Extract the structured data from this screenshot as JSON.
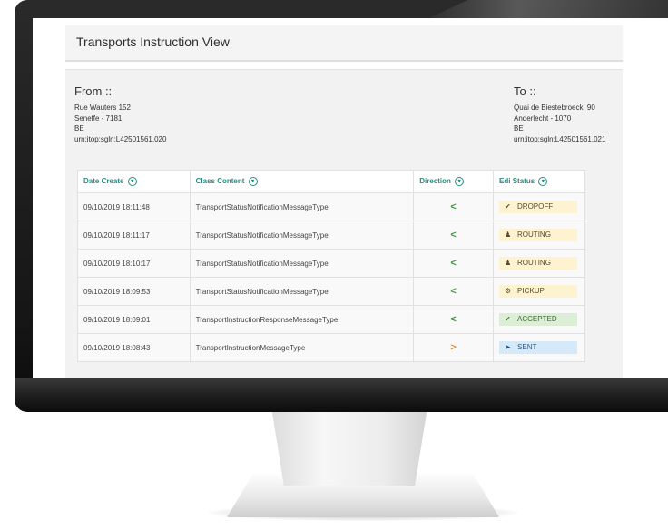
{
  "page": {
    "title": "Transports Instruction View"
  },
  "from": {
    "heading": "From ::",
    "lines": [
      "Rue Wauters 152",
      "Seneffe - 7181",
      "BE",
      "urn:itop:sgln:L42501561.020"
    ]
  },
  "to": {
    "heading": "To ::",
    "lines": [
      "Quai de Biestebroeck, 90",
      "Anderlecht - 1070",
      "BE",
      "urn:itop:sgln:L42501561.021"
    ]
  },
  "table": {
    "columns": [
      "Date Create",
      "Class Content",
      "Direction",
      "Edi Status"
    ],
    "rows": [
      {
        "date": "09/10/2019 18:11:48",
        "class": "TransportStatusNotificationMessageType",
        "direction": "<",
        "status": "DROPOFF",
        "status_icon": "check-icon"
      },
      {
        "date": "09/10/2019 18:11:17",
        "class": "TransportStatusNotificationMessageType",
        "direction": "<",
        "status": "ROUTING",
        "status_icon": "person-icon"
      },
      {
        "date": "09/10/2019 18:10:17",
        "class": "TransportStatusNotificationMessageType",
        "direction": "<",
        "status": "ROUTING",
        "status_icon": "person-icon"
      },
      {
        "date": "09/10/2019 18:09:53",
        "class": "TransportStatusNotificationMessageType",
        "direction": "<",
        "status": "PICKUP",
        "status_icon": "gear-icon"
      },
      {
        "date": "09/10/2019 18:09:01",
        "class": "TransportInstructionResponseMessageType",
        "direction": "<",
        "status": "ACCEPTED",
        "status_icon": "check-icon"
      },
      {
        "date": "09/10/2019 18:08:43",
        "class": "TransportInstructionMessageType",
        "direction": ">",
        "status": "SENT",
        "status_icon": "send-icon"
      }
    ]
  },
  "colors": {
    "header_text": "#2a8a7e",
    "incoming_arrow": "#3a9a3a",
    "outgoing_arrow": "#f08a1e",
    "status_yellow": "#fdf3d0",
    "status_green": "#dcefd6",
    "status_blue": "#d6e9f8"
  }
}
